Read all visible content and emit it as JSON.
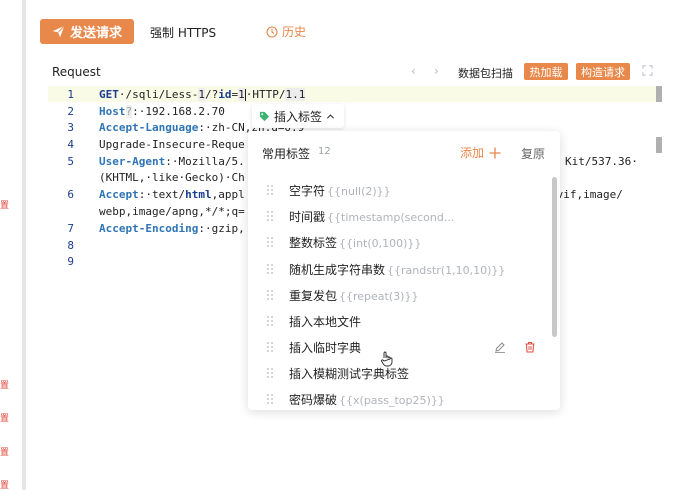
{
  "left_marks": [
    "置",
    "置",
    "置",
    "置",
    "置"
  ],
  "toolbar": {
    "send_label": "发送请求",
    "force_https_label": "强制 HTTPS",
    "history_label": "历史"
  },
  "request": {
    "title": "Request",
    "prev_arrow": "‹",
    "next_arrow": "›",
    "scan_label": "数据包扫描",
    "hot_load_label": "热加载",
    "build_request_label": "构造请求"
  },
  "editor": {
    "line_numbers": [
      "1",
      "2",
      "3",
      "4",
      "5",
      "",
      "6",
      "",
      "7",
      "8",
      "9"
    ],
    "lines": {
      "l1_method": "GET",
      "l1_p1": "·/sqli/Less-",
      "l1_p2": "1",
      "l1_p3": "/?",
      "l1_p4": "id",
      "l1_p5": "=",
      "l1_p6": "1",
      "l1_p7": "·HTTP/",
      "l1_p8": "1.1",
      "l2_key": "Host",
      "l2_q": "?",
      "l2_val": ":·192.168.2.70",
      "l3_key": "Accept-Language",
      "l3_val": ":·zh-CN,zh;q=0.9",
      "l4_text": "Upgrade-Insecure-Reque",
      "l5_key": "User-Agent",
      "l5_val": ":·Mozilla/5.",
      "l5_tail": "Kit/537.36·",
      "l5b": "(KHTML,·like·Gecko)·Ch",
      "l6_key": "Accept",
      "l6_val": ":·text/",
      "l6_kw": "html",
      "l6_val2": ",appl",
      "l6_tail": "avif,image/",
      "l6b": "webp,image/apng,*/*;q=",
      "l7_key": "Accept-Encoding",
      "l7_val": ":·gzip,"
    }
  },
  "insert_tag": {
    "label": "插入标签"
  },
  "tag_panel": {
    "title": "常用标签",
    "count": "12",
    "add_label": "添加",
    "reset_label": "复原",
    "items": [
      {
        "label": "空字符",
        "hint": "{{null(2)}}"
      },
      {
        "label": "时间戳",
        "hint": "{{timestamp(second..."
      },
      {
        "label": "整数标签",
        "hint": "{{int(0,100)}}"
      },
      {
        "label": "随机生成字符串数",
        "hint": "{{randstr(1,10,10)}}"
      },
      {
        "label": "重复发包",
        "hint": "{{repeat(3)}}"
      },
      {
        "label": "插入本地文件",
        "hint": ""
      },
      {
        "label": "插入临时字典",
        "hint": ""
      },
      {
        "label": "插入模糊测试字典标签",
        "hint": ""
      },
      {
        "label": "密码爆破",
        "hint": "{{x(pass_top25)}}"
      }
    ]
  },
  "colors": {
    "accent": "#e8884a",
    "keyword": "#1a3d8f",
    "header_key": "#2f75b5",
    "delete": "#e04a3d"
  }
}
